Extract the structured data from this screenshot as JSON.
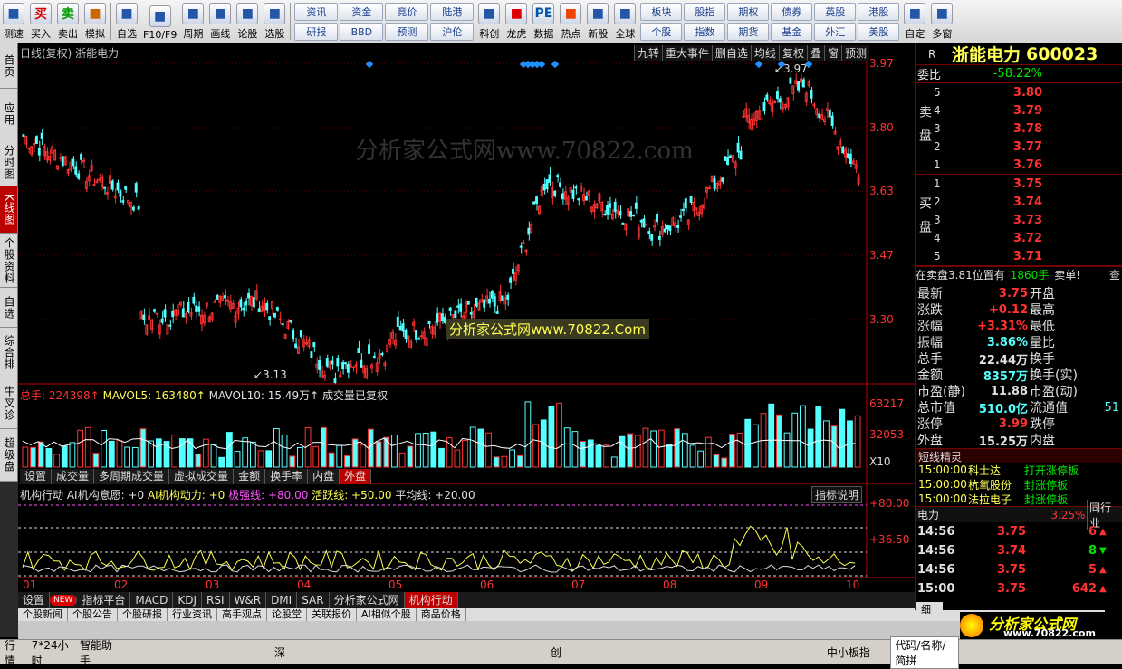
{
  "toolbar": {
    "left": [
      {
        "label": "测速",
        "icon": "clock-icon"
      },
      {
        "label": "买入",
        "icon": "buy-icon",
        "glyph": "买"
      },
      {
        "label": "卖出",
        "icon": "sell-icon",
        "glyph": "卖"
      },
      {
        "label": "模拟",
        "icon": "hammer-icon"
      },
      {
        "label": "自选",
        "icon": "star-icon"
      },
      {
        "label": "F10/F9",
        "icon": "f10-icon"
      },
      {
        "label": "周期",
        "icon": "period-icon"
      },
      {
        "label": "画线",
        "icon": "pen-icon"
      },
      {
        "label": "论股",
        "icon": "discuss-icon"
      },
      {
        "label": "选股",
        "icon": "select-icon"
      }
    ],
    "grid1": [
      "资讯",
      "资金",
      "竞价",
      "陆港",
      "研报",
      "BBD",
      "预测",
      "沪伦"
    ],
    "mid": [
      {
        "label": "科创",
        "icon": "sci-icon"
      },
      {
        "label": "龙虎",
        "icon": "dragon-icon"
      },
      {
        "label": "数据",
        "icon": "pe-icon",
        "glyph": "PE"
      },
      {
        "label": "热点",
        "icon": "hot-icon"
      },
      {
        "label": "新股",
        "icon": "ipo-icon"
      },
      {
        "label": "全球",
        "icon": "globe-icon"
      }
    ],
    "grid2": [
      "板块",
      "股指",
      "期权",
      "债券",
      "英股",
      "港股",
      "个股",
      "指数",
      "期货",
      "基金",
      "外汇",
      "美股"
    ],
    "right": [
      {
        "label": "自定",
        "icon": "custom-icon"
      },
      {
        "label": "多窗",
        "icon": "multiwin-icon"
      }
    ]
  },
  "leftbar": [
    "首页",
    "应用",
    "分时图",
    "K线图",
    "个股资料",
    "自选股",
    "综合排名",
    "牛叉诊股",
    "超级盘口"
  ],
  "chart": {
    "header": "日线(复权) 浙能电力",
    "top_buttons": [
      "九转",
      "重大事件",
      "删自选",
      "均线",
      "复权",
      "叠",
      "窗",
      "预测"
    ],
    "price_labels": [
      "3.97",
      "3.80",
      "3.63",
      "3.47",
      "3.30"
    ],
    "high_label": "3.97",
    "low_label": "3.13",
    "watermark": "分析家公式网www.70822.com",
    "watermark_box": "分析家公式网www.70822.Com",
    "vol_header": {
      "total": "总手: 224398↑",
      "mavol5": "MAVOL5: 163480↑",
      "mavol10": "MAVOL10: 15.49万↑",
      "note": "成交量已复权"
    },
    "vol_labels": [
      "63217",
      "32053",
      "X10"
    ],
    "vol_tabs": [
      "设置",
      "成交量",
      "多周期成交量",
      "虚拟成交量",
      "金额",
      "换手率",
      "内盘",
      "外盘"
    ],
    "ind_header": {
      "name": "机构行动",
      "a": "AI机构意愿: +0",
      "b": "AI机构动力: +0",
      "c": "极强线: +80.00",
      "d": "活跃线: +50.00",
      "e": "平均线: +20.00"
    },
    "ind_btn": "指标说明",
    "ind_labels": [
      "+80.00",
      "+36.50"
    ],
    "months": [
      "01",
      "02",
      "03",
      "04",
      "05",
      "06",
      "07",
      "08",
      "09",
      "10"
    ],
    "bottom_tabs": [
      "设置",
      "NEW",
      "指标平台",
      "MACD",
      "KDJ",
      "RSI",
      "W&R",
      "DMI",
      "SAR",
      "分析家公式网",
      "机构行动"
    ],
    "info_tabs": [
      "个股新闻",
      "个股公告",
      "个股研报",
      "行业资讯",
      "高手观点",
      "论股堂",
      "关联报价",
      "AI相似个股",
      "商品价格"
    ]
  },
  "right": {
    "title": "浙能电力",
    "code": "600023",
    "r_mark": "R",
    "weibi_label": "委比",
    "weibi_value": "-58.22%",
    "sell_label": "卖盘",
    "buy_label": "买盘",
    "sell": [
      [
        "5",
        "3.80"
      ],
      [
        "4",
        "3.79"
      ],
      [
        "3",
        "3.78"
      ],
      [
        "2",
        "3.77"
      ],
      [
        "1",
        "3.76"
      ]
    ],
    "buy": [
      [
        "1",
        "3.75"
      ],
      [
        "2",
        "3.74"
      ],
      [
        "3",
        "3.73"
      ],
      [
        "4",
        "3.72"
      ],
      [
        "5",
        "3.71"
      ]
    ],
    "notice": "在卖盘3.81位置有",
    "notice_qty": "1860手",
    "notice_tail": "卖单!",
    "notice_btn": "查",
    "stats": [
      [
        "最新",
        "3.75",
        "开盘",
        ""
      ],
      [
        "涨跌",
        "+0.12",
        "最高",
        ""
      ],
      [
        "涨幅",
        "+3.31%",
        "最低",
        ""
      ],
      [
        "振幅",
        "3.86%",
        "量比",
        ""
      ],
      [
        "总手",
        "22.44万",
        "换手",
        ""
      ],
      [
        "金额",
        "8357万",
        "换手(实)",
        ""
      ],
      [
        "市盈(静)",
        "11.88",
        "市盈(动)",
        ""
      ],
      [
        "总市值",
        "510.0亿",
        "流通值",
        "51"
      ],
      [
        "涨停",
        "3.99",
        "跌停",
        ""
      ],
      [
        "外盘",
        "15.25万",
        "内盘",
        ""
      ]
    ],
    "elf_title": "短线精灵",
    "elf": [
      [
        "15:00:00",
        "科士达",
        "打开涨停板"
      ],
      [
        "15:00:00",
        "杭氧股份",
        "封涨停板"
      ],
      [
        "15:00:00",
        "法拉电子",
        "封涨停板"
      ]
    ],
    "sector": "电力",
    "sector_pct": "3.25%",
    "sector_btn": "同行业",
    "ticks": [
      [
        "14:56",
        "3.75",
        "6"
      ],
      [
        "14:56",
        "3.74",
        "8"
      ],
      [
        "14:56",
        "3.75",
        "5"
      ],
      [
        "15:00",
        "3.75",
        "642"
      ]
    ],
    "ticks_tab": "细"
  },
  "status": {
    "items": [
      "行情",
      "7*24小时",
      "智能助手"
    ],
    "mid": [
      "深",
      "创",
      "中小板指"
    ],
    "search": "代码/名称/简拼"
  },
  "logo": {
    "text": "分析家公式网",
    "url": "www.70822.com"
  }
}
